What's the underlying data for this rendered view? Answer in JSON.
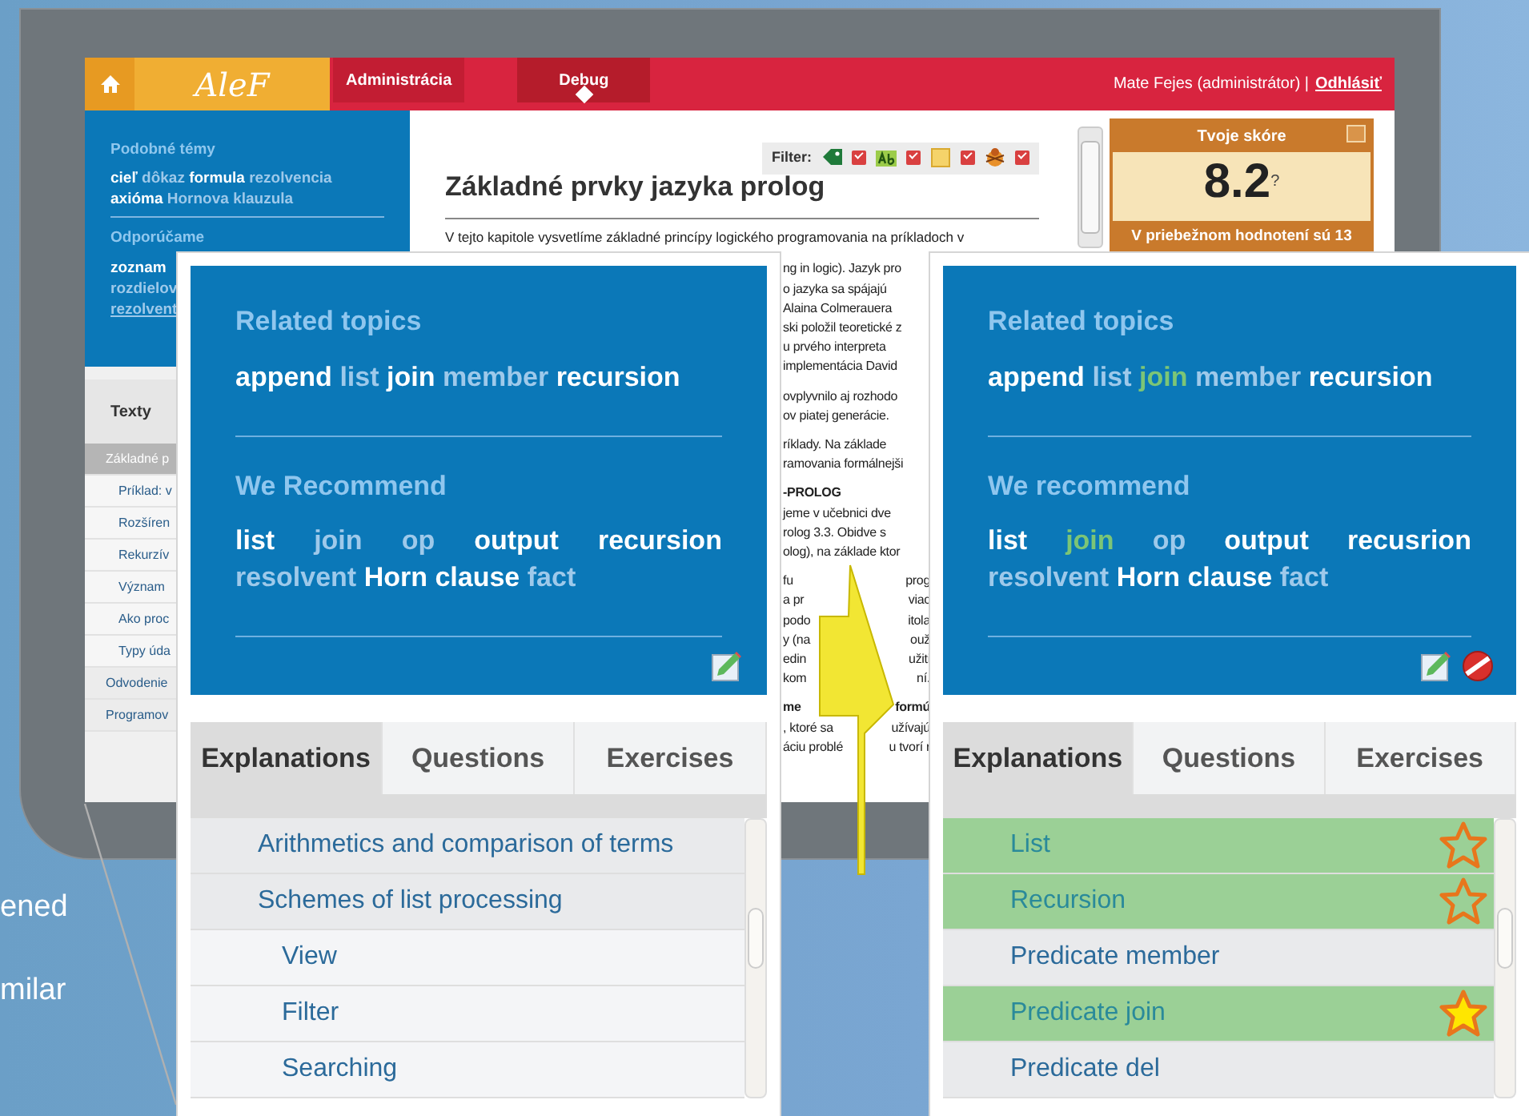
{
  "slide": {
    "text_lines": [
      "ened",
      "milar"
    ]
  },
  "app": {
    "header": {
      "logo": "AleF",
      "tabs": [
        {
          "label": "Administrácia",
          "selected": false
        },
        {
          "label": "Debug",
          "selected": true
        }
      ],
      "user": "Mate Fejes (administrátor) |",
      "logout": "Odhlásiť"
    },
    "sidebar": {
      "sections": [
        {
          "title": "Podobné témy",
          "lines": [
            [
              {
                "text": "cieľ",
                "kind": "strong"
              },
              {
                "text": "dôkaz",
                "kind": "weak"
              },
              {
                "text": "formula",
                "kind": "strong"
              },
              {
                "text": "rezolvencia",
                "kind": "weak"
              }
            ],
            [
              {
                "text": "axióma",
                "kind": "strong"
              },
              {
                "text": "Hornova klauzula",
                "kind": "weak"
              }
            ]
          ]
        },
        {
          "title": "Odporúčame",
          "lines": [
            [
              {
                "text": "zoznam",
                "kind": "strong"
              }
            ],
            [
              {
                "text": "rozdielov",
                "kind": "weak"
              }
            ],
            [
              {
                "text": "rezolvent",
                "kind": "weak"
              }
            ]
          ]
        }
      ],
      "tab": "Texty",
      "items": [
        {
          "label": "Základné p",
          "selected": true,
          "children": [
            {
              "label": "Príklad: v",
              "selected": false
            },
            {
              "label": "Rozšíren",
              "selected": false
            },
            {
              "label": "Rekurzív",
              "selected": false
            },
            {
              "label": "Význam",
              "selected": false
            },
            {
              "label": "Ako proc",
              "selected": false
            },
            {
              "label": "Typy úda",
              "selected": false
            }
          ]
        },
        {
          "label": "Odvodenie",
          "selected": false
        },
        {
          "label": "Programov",
          "selected": false
        }
      ]
    },
    "filter": {
      "label": "Filter:",
      "options": [
        {
          "kind": "tag",
          "checked": true
        },
        {
          "kind": "text",
          "checked": true
        },
        {
          "kind": "note",
          "checked": true
        },
        {
          "kind": "bug",
          "checked": true
        }
      ]
    },
    "article": {
      "title": "Základné prvky jazyka prolog",
      "intro": "V tejto kapitole vysvetlíme základné princípy logického programovania na príkladoch v",
      "paragraphs": [
        [
          {
            "left": "ng in logic). Jazyk pro"
          },
          {
            "left": "o jazyka sa spájajú"
          },
          {
            "left": "Alaina Colmerauera"
          },
          {
            "left": "ski položil teoretické z"
          },
          {
            "left": "u prvého interpreta"
          },
          {
            "left": "implementácia David"
          }
        ],
        [
          {
            "left": "ovplyvnilo aj rozhodo"
          },
          {
            "left": "ov piatej generácie."
          }
        ],
        [
          {
            "left": "ríklady. Na základe"
          },
          {
            "left": "ramovania formálnejši"
          }
        ],
        [
          {
            "left": "-PROLOG",
            "bold": true
          },
          {
            "left": "jeme v učebnici dve"
          },
          {
            "left": "rolog 3.3. Obidve s"
          },
          {
            "left": "olog), na základe ktor"
          }
        ],
        [
          {
            "left": "fu",
            "right": "prog"
          },
          {
            "left": "a pr",
            "right": "viac"
          },
          {
            "left": "podo",
            "right": "itola"
          },
          {
            "left": "y (na",
            "right": "ouž"
          },
          {
            "left": "edin",
            "right": "užiti"
          },
          {
            "left": "kom",
            "right": "ní."
          }
        ],
        [
          {
            "left": "me",
            "right": "formú",
            "bold": true
          },
          {
            "left": ", ktoré sa",
            "right": "užívajú"
          },
          {
            "left": "áciu problé",
            "right": "u tvorí r"
          }
        ]
      ]
    },
    "score": {
      "title": "Tvoje skóre",
      "value": "8.2",
      "hint": "?",
      "note": "V priebežnom hodnotení sú 13"
    }
  },
  "callouts": [
    {
      "related": {
        "title": "Related topics",
        "words": [
          {
            "text": "append",
            "kind": "strong"
          },
          {
            "text": "list",
            "kind": "weak"
          },
          {
            "text": "join",
            "kind": "strong"
          },
          {
            "text": "member",
            "kind": "weak"
          },
          {
            "text": "recursion",
            "kind": "strong"
          }
        ]
      },
      "recommend": {
        "title": "We Recommend",
        "words": [
          {
            "text": "list",
            "kind": "strong"
          },
          {
            "text": "join",
            "kind": "weak"
          },
          {
            "text": "op",
            "kind": "weak"
          },
          {
            "text": "output",
            "kind": "strong"
          },
          {
            "text": "recursion",
            "kind": "strong"
          },
          {
            "text": "resolvent",
            "kind": "weak"
          },
          {
            "text": "Horn clause",
            "kind": "strong"
          },
          {
            "text": "fact",
            "kind": "weak"
          }
        ]
      },
      "tools": [
        {
          "kind": "edit"
        }
      ],
      "tabs": [
        {
          "label": "Explanations",
          "selected": true
        },
        {
          "label": "Questions",
          "selected": false
        },
        {
          "label": "Exercises",
          "selected": false
        }
      ],
      "items": [
        {
          "label": "Arithmetics and comparison of terms",
          "highlighted": false
        },
        {
          "label": "Schemes of list processing",
          "highlighted": false,
          "children": [
            {
              "label": "View",
              "highlighted": false
            },
            {
              "label": "Filter",
              "highlighted": false
            },
            {
              "label": "Searching",
              "highlighted": false
            }
          ]
        }
      ]
    },
    {
      "related": {
        "title": "Related topics",
        "words": [
          {
            "text": "append",
            "kind": "strong"
          },
          {
            "text": "list",
            "kind": "weak"
          },
          {
            "text": "join",
            "kind": "match"
          },
          {
            "text": "member",
            "kind": "weak"
          },
          {
            "text": "recursion",
            "kind": "strong"
          }
        ]
      },
      "recommend": {
        "title": "We recommend",
        "words": [
          {
            "text": "list",
            "kind": "strong"
          },
          {
            "text": "join",
            "kind": "match"
          },
          {
            "text": "op",
            "kind": "weak"
          },
          {
            "text": "output",
            "kind": "strong"
          },
          {
            "text": "recusrion",
            "kind": "strong"
          },
          {
            "text": "resolvent",
            "kind": "weak"
          },
          {
            "text": "Horn clause",
            "kind": "strong"
          },
          {
            "text": "fact",
            "kind": "weak"
          }
        ]
      },
      "tools": [
        {
          "kind": "edit"
        },
        {
          "kind": "remove"
        }
      ],
      "tabs": [
        {
          "label": "Explanations",
          "selected": true
        },
        {
          "label": "Questions",
          "selected": false
        },
        {
          "label": "Exercises",
          "selected": false
        }
      ],
      "items": [
        {
          "label": "List",
          "highlighted": true,
          "starred": false
        },
        {
          "label": "Recursion",
          "highlighted": true,
          "starred": false
        },
        {
          "label": "Predicate member",
          "highlighted": false
        },
        {
          "label": "Predicate join",
          "highlighted": true,
          "starred": true
        },
        {
          "label": "Predicate del",
          "highlighted": false
        }
      ]
    }
  ]
}
